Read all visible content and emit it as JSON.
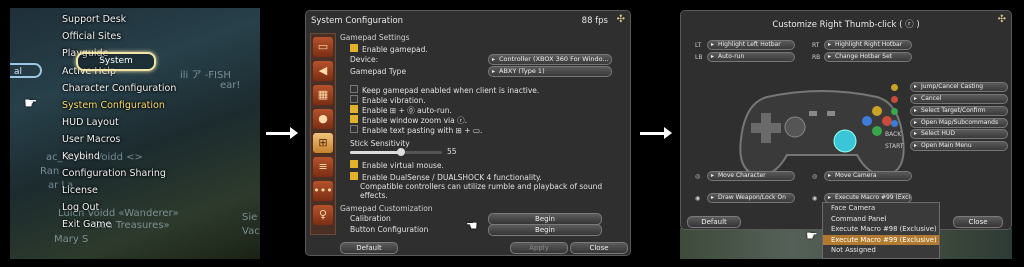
{
  "panel1": {
    "menu": [
      "Support Desk",
      "Official Sites",
      "Playguide",
      "Active Help",
      "Character Configuration",
      "System Configuration",
      "HUD Layout",
      "User Macros",
      "Keybind",
      "Configuration Sharing",
      "License",
      "Log Out",
      "Exit Game"
    ],
    "selected_label": "System",
    "selected_index": 5,
    "left_pill": "al",
    "bg_texts": [
      "ili ア -FISH",
      "ear!",
      "ac_ Luicn Voidd <>",
      "Ran",
      "ar La",
      "Sie",
      "Luicn Voidd «Wanderer»",
      "Vac",
      "«Sea Treasures»",
      "Mary S"
    ]
  },
  "panel2": {
    "title": "System Configuration",
    "fps": "88 fps",
    "section1": "Gamepad Settings",
    "enable_gamepad": "Enable gamepad.",
    "device_label": "Device:",
    "device_value": "Controller (XBOX 360 For Windo...",
    "type_label": "Gamepad Type",
    "type_value": "ABXY (Type 1)",
    "options": [
      {
        "label": "Keep gamepad enabled when client is inactive.",
        "on": false
      },
      {
        "label": "Enable vibration.",
        "on": false
      },
      {
        "label": "Enable ⊞ + ⓪ auto-run.",
        "on": true
      },
      {
        "label": "Enable window zoom via ⓡ.",
        "on": true
      },
      {
        "label": "Enable text pasting with ⊞ + ▭.",
        "on": false
      }
    ],
    "stick_label": "Stick Sensitivity",
    "stick_value": "55",
    "stick_fraction": 0.55,
    "virtual_mouse": "Enable virtual mouse.",
    "dualsense": "Enable DualSense / DUALSHOCK 4 functionality.",
    "dualsense_note": "Compatible controllers can utilize rumble and playback of sound effects.",
    "section2": "Gamepad Customization",
    "calibration": "Calibration",
    "button_config": "Button Configuration",
    "begin": "Begin",
    "default": "Default",
    "apply": "Apply",
    "close": "Close"
  },
  "panel3": {
    "title": "Customize Right Thumb-click ( ⓡ )",
    "lt": "LT",
    "rt": "RT",
    "lb": "LB",
    "rb": "RB",
    "lt_value": "Highlight Left Hotbar",
    "rt_value": "Highlight Right Hotbar",
    "lb_value": "Auto-run",
    "rb_value": "Change Hotbar Set",
    "right_list": [
      "Jump/Cancel Casting",
      "Cancel",
      "Select Target/Confirm",
      "Open Map/Subcommands",
      "Select HUD",
      "Open Main Menu"
    ],
    "back": "BACK",
    "start": "START",
    "move_char": "Move Character",
    "move_cam": "Move Camera",
    "draw": "Draw Weapon/Lock On",
    "exec99": "Execute Macro #99 (Exclu...",
    "default": "Default",
    "close": "Close",
    "dropdown": [
      "Face Camera",
      "Command Panel",
      "Execute Macro #98 (Exclusive)",
      "Execute Macro #99 (Exclusive)",
      "Not Assigned"
    ],
    "dropdown_selected": 3
  }
}
